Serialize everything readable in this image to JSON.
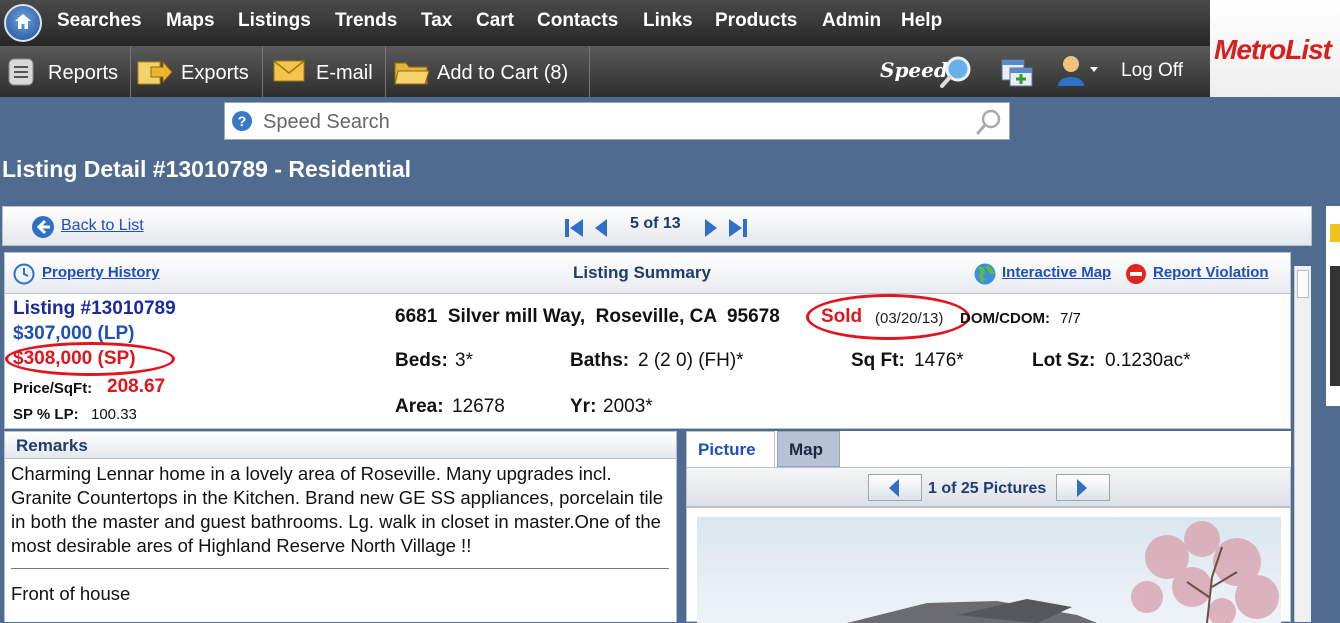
{
  "topnav": {
    "items": [
      "Searches",
      "Maps",
      "Listings",
      "Trends",
      "Tax",
      "Cart",
      "Contacts",
      "Links",
      "Products",
      "Admin",
      "Help"
    ]
  },
  "toolbar": {
    "reports": "Reports",
    "exports": "Exports",
    "email": "E-mail",
    "add_to_cart": "Add to Cart (8)",
    "logoff": "Log Off",
    "speed_logo": "Speed"
  },
  "brand": {
    "logo": "MetroList"
  },
  "search": {
    "placeholder": "Speed Search"
  },
  "page": {
    "title": "Listing Detail #13010789 - Residential"
  },
  "listnav": {
    "back": "Back to List",
    "position": "5 of 13"
  },
  "summary": {
    "property_history": "Property History",
    "title": "Listing Summary",
    "interactive_map": "Interactive Map",
    "report_violation": "Report Violation",
    "listing_no": "Listing #13010789",
    "list_price": "$307,000 (LP)",
    "sold_price": "$308,000 (SP)",
    "price_sqft_label": "Price/SqFt:",
    "price_sqft": "208.67",
    "sp_lp_label": "SP % LP:",
    "sp_lp": "100.33",
    "address": "6681  Silver mill Way,  Roseville, CA  95678",
    "status": "Sold",
    "status_date": "(03/20/13)",
    "dom_label": "DOM/CDOM:",
    "dom": "7/7",
    "beds_label": "Beds:",
    "beds": "3*",
    "baths_label": "Baths:",
    "baths": "2 (2 0) (FH)*",
    "sqft_label": "Sq Ft:",
    "sqft": "1476*",
    "lot_label": "Lot Sz:",
    "lot": "0.1230ac*",
    "area_label": "Area:",
    "area": "12678",
    "yr_label": "Yr:",
    "yr": "2003*"
  },
  "remarks": {
    "title": "Remarks",
    "text": "Charming Lennar home in a lovely area of Roseville. Many upgrades incl. Granite Countertops in the Kitchen. Brand new GE SS appliances, porcelain tile in both the master and guest bathrooms. Lg. walk in closet in master.One of the most desirable ares of Highland Reserve North Village !!",
    "caption": "Front of house"
  },
  "pictures": {
    "tab_picture": "Picture",
    "tab_map": "Map",
    "counter": "1 of 25 Pictures"
  },
  "colors": {
    "accent_red": "#e0161f",
    "link_blue": "#1f4fb8",
    "nav_bg": "#2b2b2b",
    "page_bg": "#4f6b8f"
  }
}
